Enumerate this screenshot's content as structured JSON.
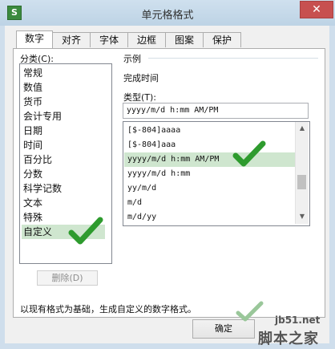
{
  "window": {
    "app_icon_glyph": "S",
    "title": "单元格格式",
    "close_glyph": "✕"
  },
  "tabs": [
    {
      "label": "数字",
      "active": true
    },
    {
      "label": "对齐",
      "active": false
    },
    {
      "label": "字体",
      "active": false
    },
    {
      "label": "边框",
      "active": false
    },
    {
      "label": "图案",
      "active": false
    },
    {
      "label": "保护",
      "active": false
    }
  ],
  "category": {
    "label": "分类(C):",
    "items": [
      "常规",
      "数值",
      "货币",
      "会计专用",
      "日期",
      "时间",
      "百分比",
      "分数",
      "科学记数",
      "文本",
      "特殊",
      "自定义"
    ],
    "selected": "自定义"
  },
  "sample": {
    "label": "示例",
    "value": "完成时间"
  },
  "type": {
    "label": "类型(T):",
    "input_value": "yyyy/m/d h:mm AM/PM",
    "items": [
      "[$-804]aaaa",
      "[$-804]aaa",
      "yyyy/m/d h:mm AM/PM",
      "yyyy/m/d h:mm",
      "yy/m/d",
      "m/d",
      "m/d/yy"
    ],
    "selected": "yyyy/m/d h:mm AM/PM"
  },
  "buttons": {
    "delete_label": "删除(D)",
    "ok_label": "确定"
  },
  "description": "以现有格式为基础，生成自定义的数字格式。",
  "scroll": {
    "up_glyph": "▲",
    "down_glyph": "▼"
  },
  "watermark": {
    "site": "jb51.net",
    "name": "脚本之家"
  },
  "colors": {
    "selection": "#cfe6cf",
    "check_green": "#2e9b2e",
    "titlebar": "#c6d9e9",
    "close_button": "#c75050"
  }
}
